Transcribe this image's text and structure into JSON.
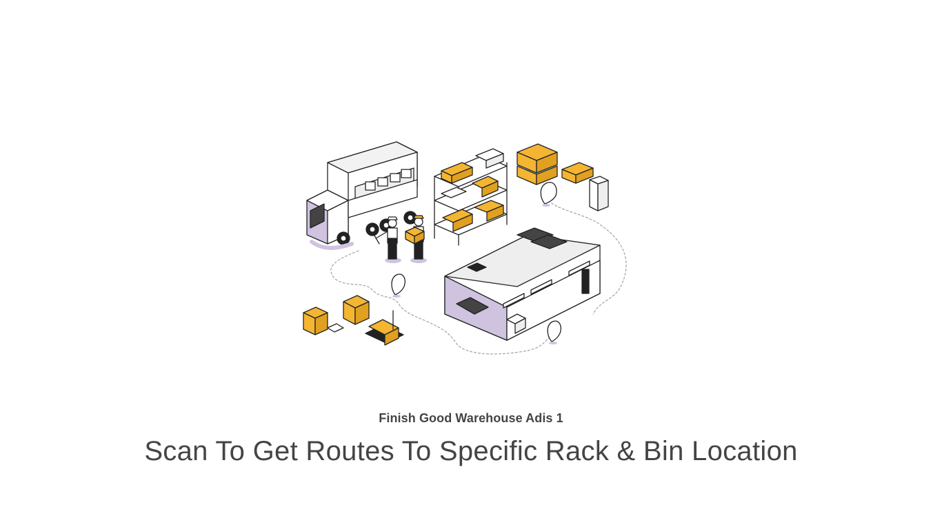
{
  "illustration": {
    "name": "warehouse-logistics-illustration",
    "colors": {
      "accent": "#F4B533",
      "lavender": "#CFC3E0",
      "stroke": "#222222",
      "light": "#F2F2F2"
    }
  },
  "warehouse_name": "Finish Good Warehouse Adis 1",
  "instruction": "Scan To Get Routes To Specific Rack & Bin Location"
}
